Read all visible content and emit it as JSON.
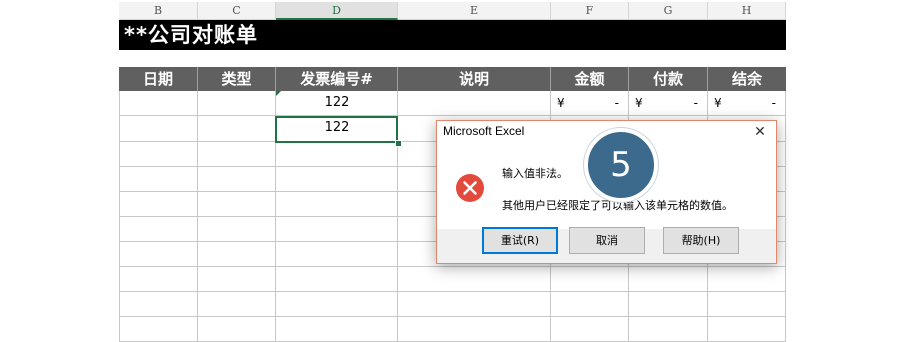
{
  "column_headers": [
    "B",
    "C",
    "D",
    "E",
    "F",
    "G",
    "H"
  ],
  "selected_column": "D",
  "sheet_title": "**公司对账单",
  "table_headers": [
    "日期",
    "类型",
    "发票编号#",
    "说明",
    "金额",
    "付款",
    "结余"
  ],
  "rows": [
    {
      "invoice": "122",
      "amount_symbol": "¥",
      "amount": "-",
      "payment_symbol": "¥",
      "payment": "-",
      "balance_symbol": "¥",
      "balance": "-"
    },
    {
      "invoice": "122"
    }
  ],
  "dialog": {
    "title": "Microsoft Excel",
    "close": "✕",
    "message_line1": "输入值非法。",
    "message_line2": "其他用户已经限定了可以输入该单元格的数值。",
    "buttons": {
      "retry": "重试(R)",
      "cancel": "取消",
      "help": "帮助(H)"
    }
  },
  "step_badge": "5",
  "colors": {
    "header_bg": "#606060",
    "title_bg": "#000000",
    "selection": "#217346",
    "badge": "#3b6a8c",
    "error_icon": "#e24b3b"
  }
}
